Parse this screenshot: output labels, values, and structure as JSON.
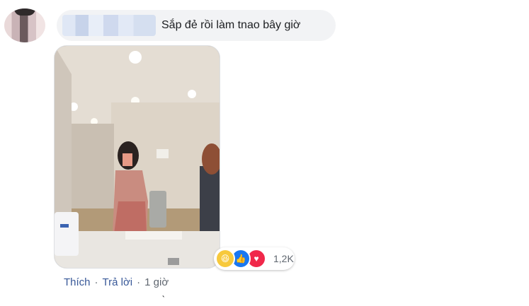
{
  "comment": {
    "author_name": "",
    "text": "Sắp đẻ rồi làm tnao bây giờ"
  },
  "reactions": {
    "icons": [
      "haha-icon",
      "like-icon",
      "love-icon"
    ],
    "count": "1,2K",
    "colors": {
      "haha": "#f7c93c",
      "like": "#1877f2",
      "love": "#f0284a"
    }
  },
  "actions": {
    "like_label": "Thích",
    "separator": "·",
    "reply_label": "Trả lời",
    "time": "1 giờ"
  },
  "stray_char": "̀",
  "colors": {
    "bubble_bg": "#f2f3f5",
    "link": "#385898",
    "meta": "#606770"
  }
}
